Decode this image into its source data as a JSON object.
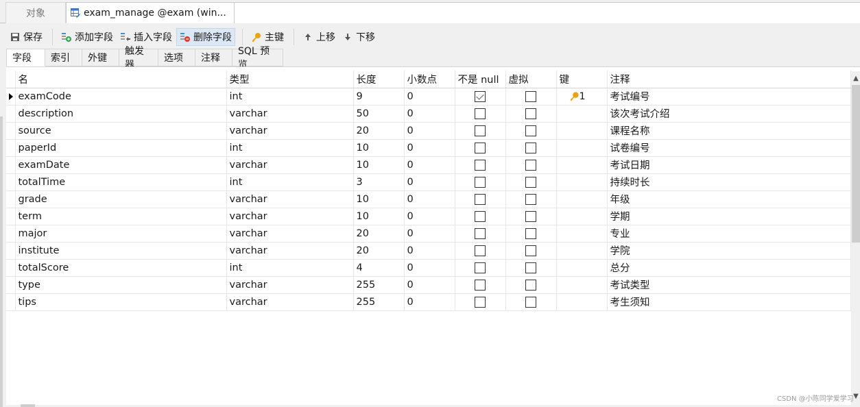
{
  "tabs": {
    "objects_label": "对象",
    "active_label": "exam_manage @exam (win..."
  },
  "toolbar": {
    "save": "保存",
    "add_field": "添加字段",
    "insert_field": "插入字段",
    "delete_field": "删除字段",
    "primary_key": "主键",
    "move_up": "上移",
    "move_down": "下移"
  },
  "subtabs": [
    "字段",
    "索引",
    "外键",
    "触发器",
    "选项",
    "注释",
    "SQL 预览"
  ],
  "columns": [
    "名",
    "类型",
    "长度",
    "小数点",
    "不是 null",
    "虚拟",
    "键",
    "注释"
  ],
  "rows": [
    {
      "name": "examCode",
      "type": "int",
      "length": "9",
      "decimals": "0",
      "not_null": true,
      "virtual": false,
      "key": "1",
      "comment": "考试编号"
    },
    {
      "name": "description",
      "type": "varchar",
      "length": "50",
      "decimals": "0",
      "not_null": false,
      "virtual": false,
      "key": "",
      "comment": "该次考试介绍"
    },
    {
      "name": "source",
      "type": "varchar",
      "length": "20",
      "decimals": "0",
      "not_null": false,
      "virtual": false,
      "key": "",
      "comment": "课程名称"
    },
    {
      "name": "paperId",
      "type": "int",
      "length": "10",
      "decimals": "0",
      "not_null": false,
      "virtual": false,
      "key": "",
      "comment": "试卷编号"
    },
    {
      "name": "examDate",
      "type": "varchar",
      "length": "10",
      "decimals": "0",
      "not_null": false,
      "virtual": false,
      "key": "",
      "comment": "考试日期"
    },
    {
      "name": "totalTime",
      "type": "int",
      "length": "3",
      "decimals": "0",
      "not_null": false,
      "virtual": false,
      "key": "",
      "comment": "持续时长"
    },
    {
      "name": "grade",
      "type": "varchar",
      "length": "10",
      "decimals": "0",
      "not_null": false,
      "virtual": false,
      "key": "",
      "comment": "年级"
    },
    {
      "name": "term",
      "type": "varchar",
      "length": "10",
      "decimals": "0",
      "not_null": false,
      "virtual": false,
      "key": "",
      "comment": "学期"
    },
    {
      "name": "major",
      "type": "varchar",
      "length": "20",
      "decimals": "0",
      "not_null": false,
      "virtual": false,
      "key": "",
      "comment": "专业"
    },
    {
      "name": "institute",
      "type": "varchar",
      "length": "20",
      "decimals": "0",
      "not_null": false,
      "virtual": false,
      "key": "",
      "comment": "学院"
    },
    {
      "name": "totalScore",
      "type": "int",
      "length": "4",
      "decimals": "0",
      "not_null": false,
      "virtual": false,
      "key": "",
      "comment": "总分"
    },
    {
      "name": "type",
      "type": "varchar",
      "length": "255",
      "decimals": "0",
      "not_null": false,
      "virtual": false,
      "key": "",
      "comment": "考试类型"
    },
    {
      "name": "tips",
      "type": "varchar",
      "length": "255",
      "decimals": "0",
      "not_null": false,
      "virtual": false,
      "key": "",
      "comment": "考生须知"
    }
  ],
  "selected_row": 0,
  "watermark": "CSDN @小陈同学爱学习",
  "colors": {
    "key_icon": "#e8a317",
    "add_icon": "#2fa84f",
    "delete_icon": "#e0392b",
    "pressed_bg": "#dce8f5"
  }
}
